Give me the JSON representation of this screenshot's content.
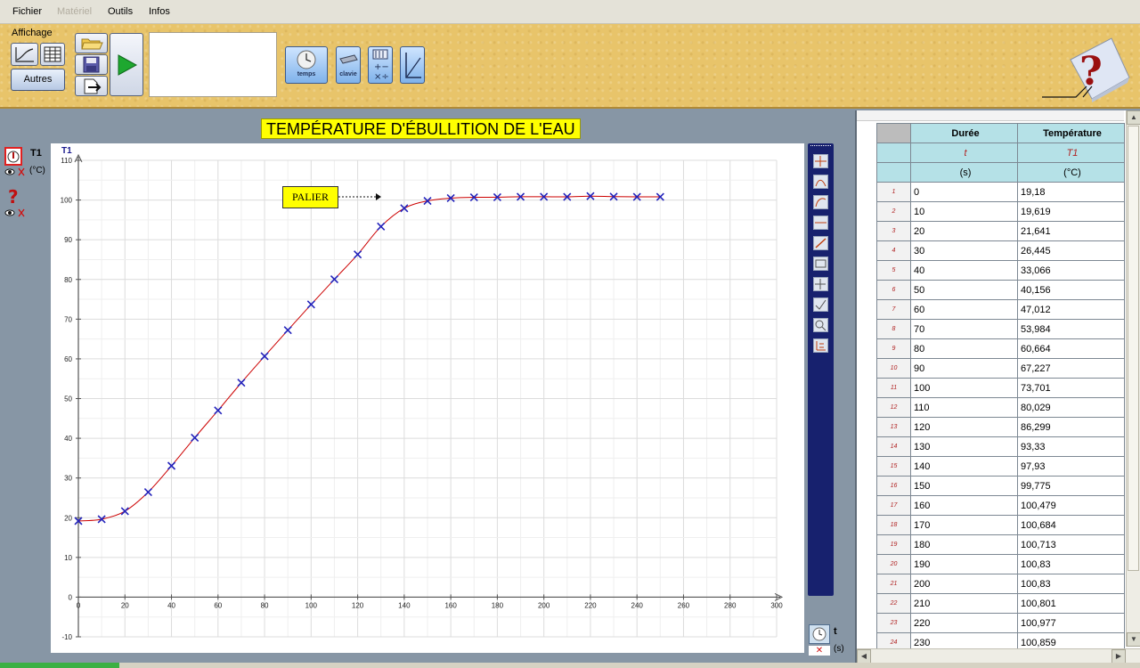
{
  "menu": {
    "fichier": "Fichier",
    "materiel": "Matériel",
    "outils": "Outils",
    "infos": "Infos"
  },
  "toolbar": {
    "affichage_label": "Affichage",
    "autres_label": "Autres",
    "temps_label": "temps",
    "clavier_label": "clavie"
  },
  "graph": {
    "title": "TEMPÉRATURE D'ÉBULLITION DE L'EAU",
    "annotation": "PALIER"
  },
  "left_panel": {
    "sensor_label": "T1",
    "sensor_unit": "(°C)"
  },
  "x_axis_panel": {
    "var": "t",
    "unit": "(s)"
  },
  "table": {
    "col1_header": "Durée",
    "col2_header": "Température",
    "col1_symbol": "t",
    "col2_symbol": "T1",
    "col1_unit": "(s)",
    "col2_unit": "(°C)",
    "rows": [
      [
        "1",
        "0",
        "19,18"
      ],
      [
        "2",
        "10",
        "19,619"
      ],
      [
        "3",
        "20",
        "21,641"
      ],
      [
        "4",
        "30",
        "26,445"
      ],
      [
        "5",
        "40",
        "33,066"
      ],
      [
        "6",
        "50",
        "40,156"
      ],
      [
        "7",
        "60",
        "47,012"
      ],
      [
        "8",
        "70",
        "53,984"
      ],
      [
        "9",
        "80",
        "60,664"
      ],
      [
        "10",
        "90",
        "67,227"
      ],
      [
        "11",
        "100",
        "73,701"
      ],
      [
        "12",
        "110",
        "80,029"
      ],
      [
        "13",
        "120",
        "86,299"
      ],
      [
        "14",
        "130",
        "93,33"
      ],
      [
        "15",
        "140",
        "97,93"
      ],
      [
        "16",
        "150",
        "99,775"
      ],
      [
        "17",
        "160",
        "100,479"
      ],
      [
        "18",
        "170",
        "100,684"
      ],
      [
        "19",
        "180",
        "100,713"
      ],
      [
        "20",
        "190",
        "100,83"
      ],
      [
        "21",
        "200",
        "100,83"
      ],
      [
        "22",
        "210",
        "100,801"
      ],
      [
        "23",
        "220",
        "100,977"
      ],
      [
        "24",
        "230",
        "100,859"
      ]
    ]
  },
  "colors": {
    "curve": "#cc0000",
    "marker": "#2222bb",
    "title_bg": "#ffff00",
    "side_toolbar": "#17216e",
    "table_header": "#b5e1e7"
  },
  "chart_data": {
    "type": "scatter",
    "title": "TEMPÉRATURE D'ÉBULLITION DE L'EAU",
    "xlabel": "t",
    "ylabel": "T1",
    "xlim": [
      0,
      300
    ],
    "ylim": [
      -10,
      110
    ],
    "x_ticks": [
      "0",
      "20",
      "40",
      "60",
      "80",
      "100",
      "120",
      "140",
      "160",
      "180",
      "200",
      "220",
      "240",
      "260",
      "280",
      "300"
    ],
    "y_ticks": [
      "-10",
      "0",
      "10",
      "20",
      "30",
      "40",
      "50",
      "60",
      "70",
      "80",
      "90",
      "100",
      "110"
    ],
    "grid": true,
    "x": [
      0,
      10,
      20,
      30,
      40,
      50,
      60,
      70,
      80,
      90,
      100,
      110,
      120,
      130,
      140,
      150,
      160,
      170,
      180,
      190,
      200,
      210,
      220,
      230,
      240,
      250
    ],
    "y": [
      19.18,
      19.619,
      21.641,
      26.445,
      33.066,
      40.156,
      47.012,
      53.984,
      60.664,
      67.227,
      73.701,
      80.029,
      86.299,
      93.33,
      97.93,
      99.775,
      100.479,
      100.684,
      100.713,
      100.83,
      100.83,
      100.801,
      100.977,
      100.859,
      100.8,
      100.8
    ]
  }
}
